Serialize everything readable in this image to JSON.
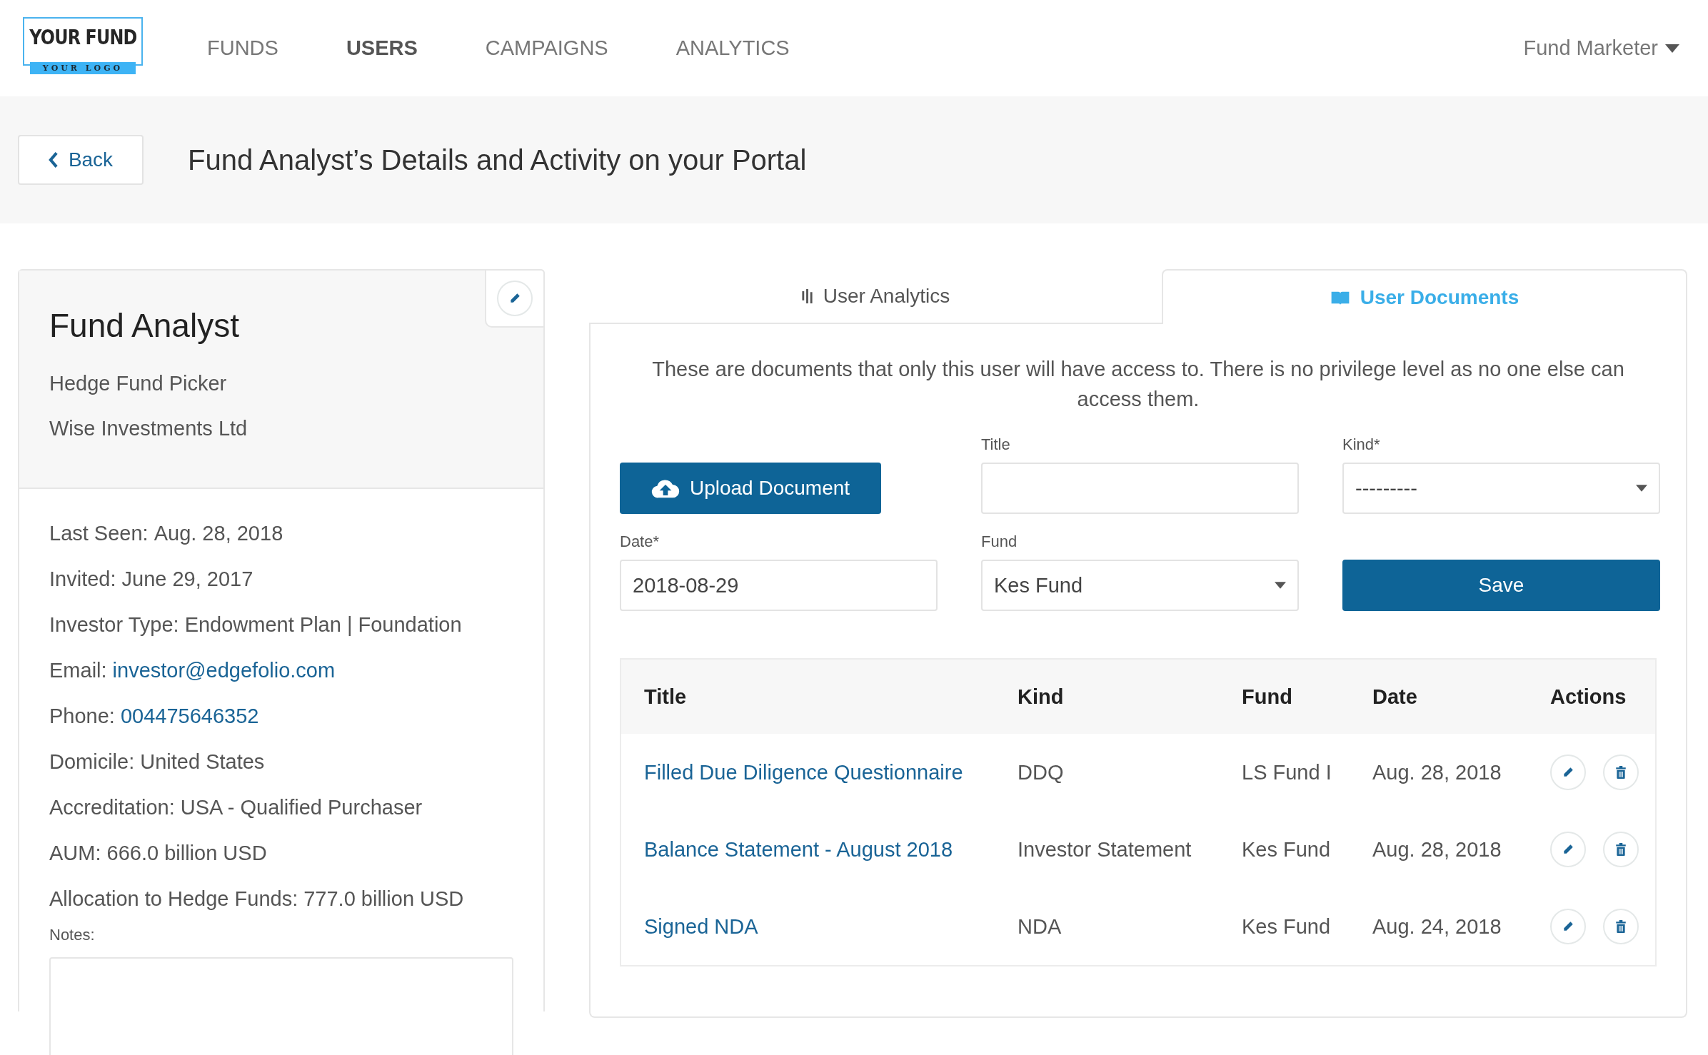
{
  "logo": {
    "title": "YOUR FUND",
    "tagline": "YOUR LOGO"
  },
  "nav": [
    {
      "label": "FUNDS",
      "selected": false
    },
    {
      "label": "USERS",
      "selected": true
    },
    {
      "label": "CAMPAIGNS",
      "selected": false
    },
    {
      "label": "ANALYTICS",
      "selected": false
    }
  ],
  "user_menu": {
    "label": "Fund Marketer"
  },
  "back_button": "Back",
  "page_title": "Fund Analyst’s Details and Activity on your Portal",
  "profile": {
    "name": "Fund Analyst",
    "subtitles": [
      "Hedge Fund Picker",
      "Wise Investments Ltd"
    ],
    "details": [
      {
        "label": "Last Seen:",
        "value": "Aug. 28, 2018",
        "kind": "text"
      },
      {
        "label": "Invited:",
        "value": "June 29, 2017",
        "kind": "text"
      },
      {
        "label": "Investor Type:",
        "value": "Endowment Plan | Foundation",
        "kind": "text"
      },
      {
        "label": "Email:",
        "value": "investor@edgefolio.com",
        "kind": "link"
      },
      {
        "label": "Phone:",
        "value": "004475646352",
        "kind": "link"
      },
      {
        "label": "Domicile:",
        "value": "United States",
        "kind": "text"
      },
      {
        "label": "Accreditation:",
        "value": "USA - Qualified Purchaser",
        "kind": "text"
      },
      {
        "label": "AUM:",
        "value": "666.0 billion USD",
        "kind": "text"
      },
      {
        "label": "Allocation to Hedge Funds:",
        "value": "777.0 billion USD",
        "kind": "text"
      }
    ],
    "notes_label": "Notes:"
  },
  "tabs": [
    {
      "label": "User Analytics",
      "kind": "analytics",
      "selected": false
    },
    {
      "label": "User Documents",
      "kind": "documents",
      "selected": true
    }
  ],
  "documents": {
    "description": "These are documents that only this user will have access to. There is no privilege level as no one else can access them.",
    "upload_button": "Upload Document",
    "title_field": {
      "label": "Title"
    },
    "kind_field": {
      "label": "Kind*",
      "value": "---------"
    },
    "date_field": {
      "label": "Date*",
      "value": "2018-08-29"
    },
    "fund_field": {
      "label": "Fund",
      "value": "Kes Fund"
    },
    "save_button": "Save",
    "table": {
      "columns": [
        "Title",
        "Kind",
        "Fund",
        "Date",
        "Actions"
      ],
      "rows": [
        {
          "title": "Filled Due Diligence Questionnaire",
          "kind": "DDQ",
          "fund": "LS Fund I",
          "date": "Aug. 28, 2018"
        },
        {
          "title": "Balance Statement - August 2018",
          "kind": "Investor Statement",
          "fund": "Kes Fund",
          "date": "Aug. 28, 2018"
        },
        {
          "title": "Signed NDA",
          "kind": "NDA",
          "fund": "Kes Fund",
          "date": "Aug. 24, 2018"
        }
      ]
    }
  }
}
